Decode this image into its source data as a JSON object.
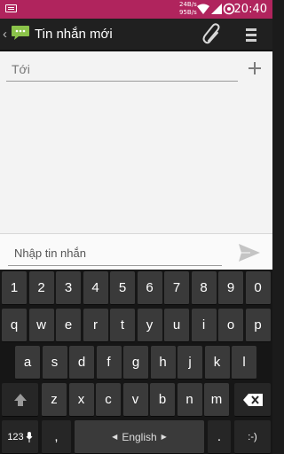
{
  "status_bar": {
    "upload_speed": "24B/s",
    "download_speed": "95B/s",
    "time": "20:40"
  },
  "action_bar": {
    "title": "Tin nhắn mới",
    "icons": [
      "back-chevron-icon",
      "messaging-app-icon",
      "paperclip-icon",
      "menu-icon"
    ]
  },
  "recipient": {
    "placeholder": "Tới",
    "value": ""
  },
  "composer": {
    "placeholder": "Nhập tin nhắn",
    "value": ""
  },
  "keyboard": {
    "row_numbers": [
      "1",
      "2",
      "3",
      "4",
      "5",
      "6",
      "7",
      "8",
      "9",
      "0"
    ],
    "row_top": [
      "q",
      "w",
      "e",
      "r",
      "t",
      "y",
      "u",
      "i",
      "o",
      "p"
    ],
    "row_middle": [
      "a",
      "s",
      "d",
      "f",
      "g",
      "h",
      "j",
      "k",
      "l"
    ],
    "row_bottom": [
      "z",
      "x",
      "c",
      "v",
      "b",
      "n",
      "m"
    ],
    "symbols_label": "123",
    "comma_label": ",",
    "space_label": "English",
    "period_label": ".",
    "smiley_label": ":-)",
    "accent_color": "#b0245d"
  }
}
